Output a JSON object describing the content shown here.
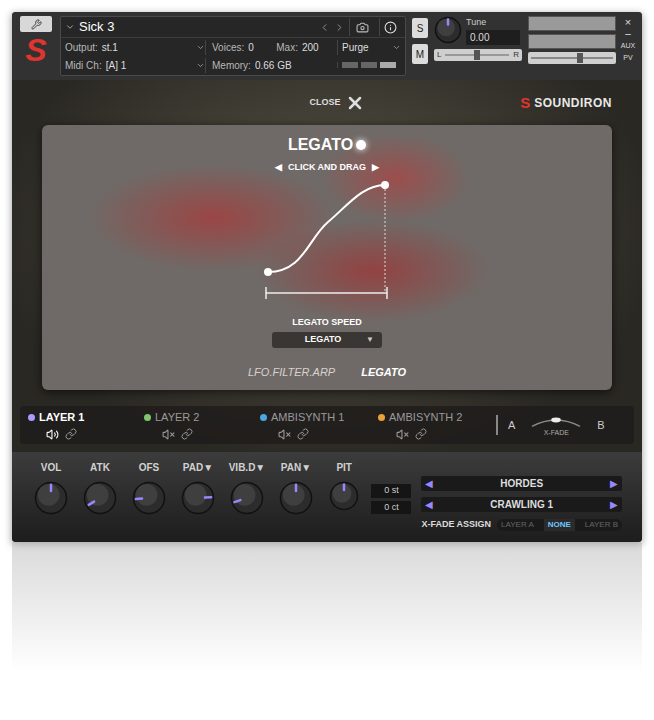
{
  "header": {
    "logo": "S",
    "instrument": "Sick 3",
    "output_label": "Output:",
    "output": "st.1",
    "voices_label": "Voices:",
    "voices": "0",
    "max_label": "Max:",
    "max": "200",
    "purge": "Purge",
    "midi_label": "Midi Ch:",
    "midi": "[A] 1",
    "memory_label": "Memory:",
    "memory": "0.66 GB",
    "solo": "S",
    "mute": "M",
    "tune_label": "Tune",
    "tune": "0.00",
    "tune_level": 0.5,
    "pan_left": "L",
    "pan_right": "R",
    "pan_level": 0.5,
    "volume_level": 0.6,
    "aux": "AUX",
    "pv": "PV",
    "close": "×",
    "minimize": "–"
  },
  "close_button": {
    "label": "CLOSE"
  },
  "brand": {
    "mark": "S",
    "name": "SOUNDIRON"
  },
  "legato_panel": {
    "title": "LEGATO",
    "enabled": true,
    "hint_left": "◀",
    "hint": "CLICK AND DRAG",
    "hint_right": "▶",
    "speed_label": "LEGATO SPEED",
    "speed_value": "LEGATO",
    "speed_arrow": "▼"
  },
  "panel_tabs": [
    {
      "label": "LFO.FILTER.ARP",
      "selected": false
    },
    {
      "label": "LEGATO",
      "selected": true
    }
  ],
  "layers": [
    {
      "label": "LAYER 1",
      "selected": true,
      "muted": false,
      "color": "#a99bff"
    },
    {
      "label": "LAYER 2",
      "selected": false,
      "muted": true,
      "color": "#7ec86b"
    },
    {
      "label": "AMBISYNTH 1",
      "selected": false,
      "muted": true,
      "color": "#4aa8e0"
    },
    {
      "label": "AMBISYNTH 2",
      "selected": false,
      "muted": true,
      "color": "#e8a33a"
    }
  ],
  "crossfade": {
    "a": "A",
    "label": "X-FADE",
    "b": "B",
    "level": 0.5
  },
  "knobs": [
    {
      "label": "VOL",
      "level": 0.5
    },
    {
      "label": "ATK",
      "level": 0.05
    },
    {
      "label": "OFS",
      "level": 0.15
    },
    {
      "label": "PAD▼",
      "level": 0.82
    },
    {
      "label": "VIB.D▼",
      "level": 0.1
    },
    {
      "label": "PAN▼",
      "level": 0.5
    }
  ],
  "pitch": {
    "label": "PIT",
    "level": 0.5,
    "semitones": "0 st",
    "cents": "0 ct"
  },
  "selectors": [
    {
      "prev": "◀",
      "value": "HORDES",
      "next": "▶"
    },
    {
      "prev": "◀",
      "value": "CRAWLING 1",
      "next": "▶"
    }
  ],
  "xfade_assign": {
    "label": "X-FADE ASSIGN",
    "options": [
      {
        "label": "LAYER A",
        "selected": false
      },
      {
        "label": "NONE",
        "selected": true
      },
      {
        "label": "LAYER B",
        "selected": false
      }
    ]
  }
}
